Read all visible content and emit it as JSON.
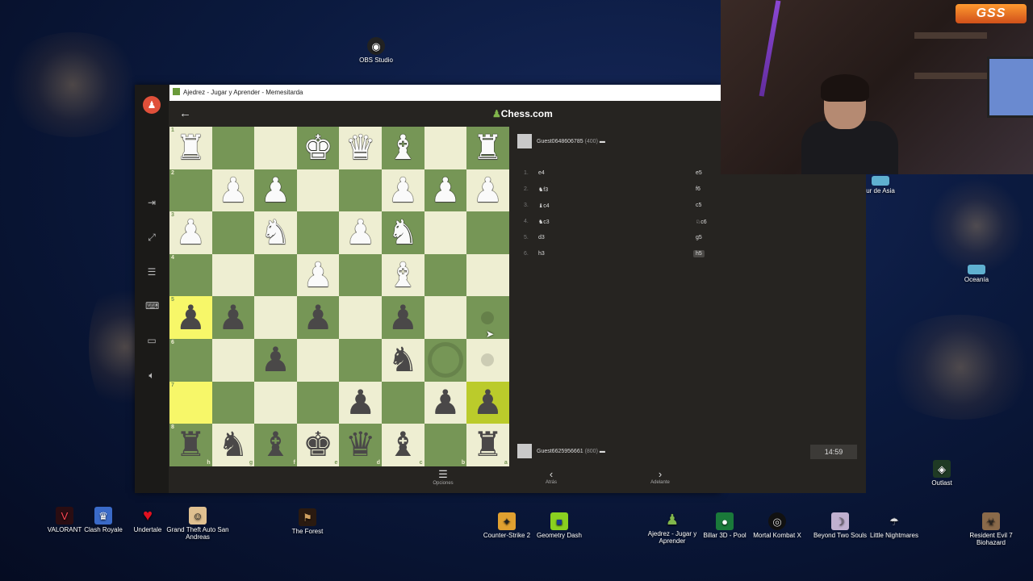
{
  "desktop": {
    "icons_top": [
      {
        "label": "OBS Studio",
        "icon": "obs-icon"
      }
    ],
    "icons_right": [
      {
        "label": "ur de Asia",
        "icon": "folder-icon"
      },
      {
        "label": "Oceanía",
        "icon": "folder-icon"
      },
      {
        "label": "Outlast",
        "icon": "outlast-icon"
      }
    ],
    "icons_bottom": [
      {
        "label": "VALORANT",
        "icon": "valorant-icon"
      },
      {
        "label": "Clash Royale",
        "icon": "clash-royale-icon"
      },
      {
        "label": "Undertale",
        "icon": "undertale-icon"
      },
      {
        "label": "Grand Theft Auto San Andreas",
        "icon": "gta-icon"
      },
      {
        "label": "The Forest",
        "icon": "the-forest-icon"
      },
      {
        "label": "Counter-Strike 2",
        "icon": "cs2-icon"
      },
      {
        "label": "Geometry Dash",
        "icon": "geometry-dash-icon"
      },
      {
        "label": "Ajedrez - Jugar y Aprender",
        "icon": "chess-icon"
      },
      {
        "label": "Billar 3D - Pool",
        "icon": "billiards-icon"
      },
      {
        "label": "Mortal Kombat X",
        "icon": "mortal-kombat-icon"
      },
      {
        "label": "Beyond Two Souls",
        "icon": "beyond-two-souls-icon"
      },
      {
        "label": "Little Nightmares",
        "icon": "little-nightmares-icon"
      },
      {
        "label": "Resident Evil 7 Biohazard",
        "icon": "resident-evil-icon"
      }
    ]
  },
  "window": {
    "title": "Ajedrez - Jugar y Aprender - Memesitarda",
    "logo": "Chess.com"
  },
  "board": {
    "rank_labels": [
      "1",
      "2",
      "3",
      "4",
      "5",
      "6",
      "7",
      "8"
    ],
    "file_labels": [
      "h",
      "g",
      "f",
      "e",
      "d",
      "c",
      "b",
      "a"
    ],
    "rows": [
      [
        "♜w",
        "",
        "",
        "♚w",
        "♛w",
        "♝w",
        "",
        "♜w"
      ],
      [
        "",
        "♟w",
        "♟w",
        "",
        "",
        "♟w",
        "♟w",
        "♟w"
      ],
      [
        "♟w",
        "",
        "♞w",
        "",
        "♟w",
        "♞w",
        "",
        ""
      ],
      [
        "",
        "",
        "",
        "♟w",
        "",
        "♝w",
        "",
        ""
      ],
      [
        "♟b",
        "♟b",
        "",
        "♟b",
        "",
        "♟b",
        "",
        "dot"
      ],
      [
        "",
        "",
        "♟b",
        "",
        "",
        "♞b",
        "ring",
        "dot"
      ],
      [
        "",
        "",
        "",
        "",
        "♟b",
        "",
        "♟b",
        "♟b"
      ],
      [
        "♜b",
        "♞b",
        "♝b",
        "♚b",
        "♛b",
        "♝b",
        "",
        "♜b"
      ]
    ],
    "highlights": {
      "hl": [
        [
          4,
          0
        ],
        [
          6,
          0
        ]
      ],
      "hl2": [
        [
          6,
          7
        ]
      ]
    }
  },
  "panel": {
    "top_player": {
      "name": "Guest0648606785",
      "rating": "(400)"
    },
    "bottom_player": {
      "name": "Guest6625956661",
      "rating": "(800)"
    },
    "moves": [
      {
        "num": "1.",
        "white": "e4",
        "black": "e5"
      },
      {
        "num": "2.",
        "white": "♞f3",
        "black": "f6"
      },
      {
        "num": "3.",
        "white": "♝c4",
        "black": "c5"
      },
      {
        "num": "4.",
        "white": "♞c3",
        "black": "♘c6"
      },
      {
        "num": "5.",
        "white": "d3",
        "black": "g5"
      },
      {
        "num": "6.",
        "white": "h3",
        "black": "h5"
      }
    ],
    "clock": "14:59"
  },
  "bottombar": {
    "options": "Opciones",
    "back": "Atrás",
    "forward": "Adelante"
  },
  "webcam": {
    "logo": "GSS"
  }
}
